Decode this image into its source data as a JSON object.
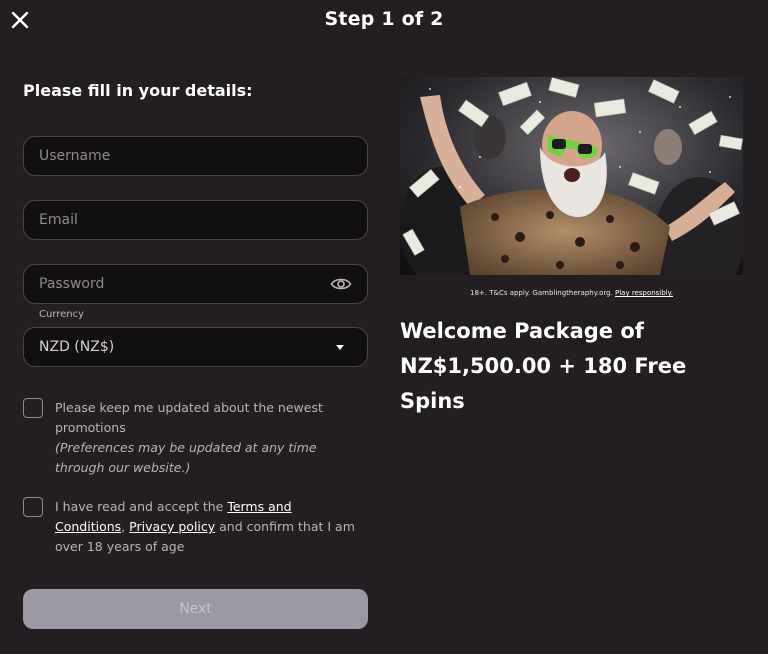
{
  "header": {
    "title": "Step 1 of 2"
  },
  "form": {
    "heading": "Please fill in your details:",
    "username_placeholder": "Username",
    "email_placeholder": "Email",
    "password_placeholder": "Password",
    "currency_label": "Currency",
    "currency_value": "NZD (NZ$)",
    "promotions_text": "Please keep me updated about the newest promotions",
    "promotions_note": "(Preferences may be updated at any time through our website.)",
    "terms_prefix": "I have read and accept the ",
    "terms_link": "Terms and Conditions",
    "terms_comma": ",",
    "privacy_link": "Privacy policy",
    "terms_suffix": " and confirm that I am over 18 years of age",
    "next_label": "Next"
  },
  "promo": {
    "disclaimer_text": "18+. T&Cs apply. Gamblingtheraphy.org. ",
    "disclaimer_link": "Play responsibly.",
    "title_line1": "Welcome Package of",
    "title_line2": "NZ$1,500.00 + 180 Free Spins"
  },
  "icons": {
    "close": "close-icon",
    "eye": "eye-icon",
    "dropdown": "caret-down-icon"
  },
  "colors": {
    "background": "#221e21",
    "field_bg": "#120f11",
    "next_button_disabled": "#9c98a4"
  }
}
